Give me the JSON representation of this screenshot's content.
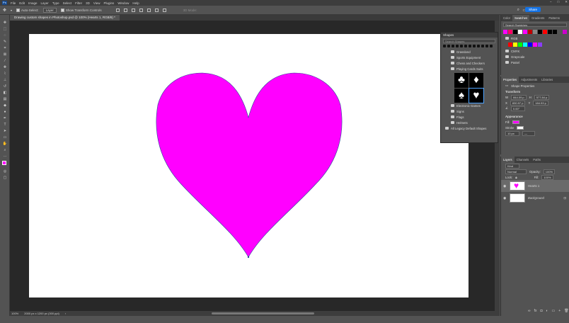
{
  "menu": [
    "File",
    "Edit",
    "Image",
    "Layer",
    "Type",
    "Select",
    "Filter",
    "3D",
    "View",
    "Plugins",
    "Window",
    "Help"
  ],
  "app_logo": "Ps",
  "options": {
    "auto_select_label": "Auto-Select:",
    "auto_select_value": "Layer",
    "show_transform_label": "Show Transform Controls",
    "mode_3d_label": "3D Mode:",
    "share_label": "Share"
  },
  "document_tab": "Drawing custom shapes in Photoshop.psd @ 100% (Hearts 1, RGB/8) *",
  "status": {
    "zoom": "100%",
    "doc_size": "2000 px x 1200 px (300 ppi)"
  },
  "shapes_panel": {
    "title": "Shapes",
    "search_placeholder": "Search Shapes",
    "rows_top": [
      "Grassland",
      "Sports Equipment",
      "Chess and Checkers",
      "Playing Cards Suits"
    ],
    "rows_bottom": [
      "Electronic Games",
      "Signs",
      "Flags",
      "Helmets"
    ],
    "legacy": "All Legacy Default Shapes",
    "suits": [
      "♣",
      "♦",
      "♠",
      "♥"
    ]
  },
  "swatches_panel": {
    "tabs": [
      "Color",
      "Swatches",
      "Gradients",
      "Patterns"
    ],
    "active_tab": "Swatches",
    "search_placeholder": "Search Swatches",
    "recent": [
      "#ff00ff",
      "#ff0066",
      "#000000",
      "#ffffff",
      "#ff00ff",
      "#c00000",
      "#888888",
      "#000000",
      "#ff0000",
      "#000000",
      "#000000",
      "#555555",
      "#cc00cc"
    ],
    "rgb_group": "RGB",
    "rgb_colors": [
      "#ff0000",
      "#ffff00",
      "#00ff00",
      "#00ffff",
      "#0000ff",
      "#ff00ff",
      "#8a3cff"
    ],
    "groups": [
      "CMYK",
      "Grayscale",
      "Pastel"
    ]
  },
  "properties_panel": {
    "tabs": [
      "Properties",
      "Adjustments",
      "Libraries"
    ],
    "active_tab": "Properties",
    "subtitle": "Shape Properties",
    "transform_heading": "Transform",
    "w": "844.09 p",
    "h": "577.84 p",
    "x": "830.97 p",
    "y": "184.53 p",
    "angle": "0.00°",
    "appearance_heading": "Appearance",
    "fill_label": "Fill",
    "stroke_label": "Stroke",
    "stroke_size": "10 px",
    "fill_color": "#ff00ff"
  },
  "layers_panel": {
    "tabs": [
      "Layers",
      "Channels",
      "Paths"
    ],
    "active_tab": "Layers",
    "filter": "Kind",
    "blend": "Normal",
    "opacity_label": "Opacity:",
    "opacity": "100%",
    "lock_label": "Lock:",
    "fill_label": "Fill:",
    "fill": "100%",
    "layers": [
      {
        "name": "Hearts 1",
        "selected": true
      },
      {
        "name": "Background",
        "selected": false
      }
    ]
  },
  "colors": {
    "heart": "#ff00ff",
    "canvas": "#ffffff",
    "workspace": "#282828",
    "accent": "#1473e6"
  }
}
